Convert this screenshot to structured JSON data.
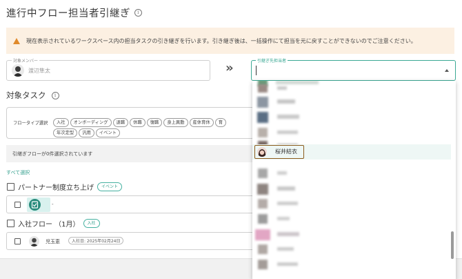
{
  "page": {
    "title": "進行中フロー担当者引継ぎ",
    "alert": "現在表示されているワークスペース内の担当タスクの引き継ぎを行います。引き継ぎ後は、一括操作にて担当を元に戻すことができないのでご注意ください。"
  },
  "from_user": {
    "label": "対象メンバー",
    "name": "渡辺隼太"
  },
  "arrow": "»",
  "to_user": {
    "label": "引継ぎ先担当者",
    "value": ""
  },
  "tasks": {
    "heading": "対象タスク",
    "flow_type_label": "フロータイプ選択",
    "flow_types_row1": [
      "入社",
      "オンボーディング",
      "退職",
      "休職",
      "復職",
      "身上異動",
      "産休育休",
      "育"
    ],
    "flow_types_row2": [
      "年次定型",
      "汎用",
      "イベント"
    ],
    "selected_count": "引継ぎフローが0件選択されています",
    "select_all": "すべて選択"
  },
  "groups": [
    {
      "name": "パートナー制度立ち上げ",
      "tag": "イベント",
      "item": {
        "text": "-"
      }
    },
    {
      "name": "入社フロー （1月）",
      "tag": "入社",
      "item": {
        "person": "児玉恵",
        "date": "入社日: 2025年02月24日"
      }
    }
  ],
  "dropdown": {
    "highlighted_name": "桜井結衣"
  },
  "colors": {
    "accent": "#2f9d8b",
    "alert_bg": "#fcf0e2",
    "warn": "#e08a2c",
    "highlight_border": "#8a5a1a"
  }
}
